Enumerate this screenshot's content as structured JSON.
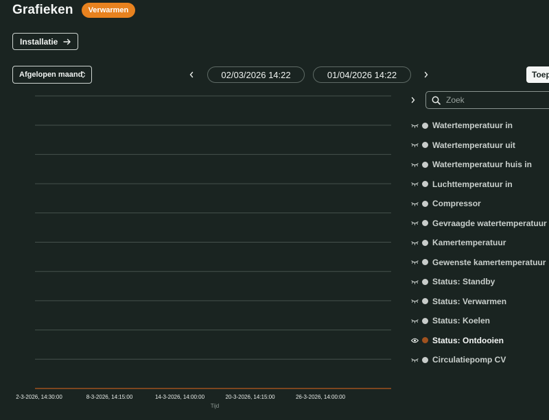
{
  "header": {
    "title": "Grafieken",
    "mode_badge": "Verwarmen"
  },
  "toolbar": {
    "installatie_label": "Installatie",
    "period_select": "Afgelopen maand",
    "date_from": "02/03/2026 14:22",
    "date_to": "01/04/2026 14:22",
    "apply_label": "Toep"
  },
  "chart_data": {
    "type": "line",
    "x": [
      "2-3-2026, 14:30:00",
      "8-3-2026, 14:15:00",
      "14-3-2026, 14:00:00",
      "20-3-2026, 14:15:00",
      "26-3-2026, 14:00:00"
    ],
    "xlabel": "Tijd",
    "ylabel": "",
    "grid": true,
    "series": [
      {
        "name": "Status: Ontdooien",
        "values": [
          0,
          0,
          0,
          0,
          0
        ],
        "color": "#a0521f"
      }
    ]
  },
  "sidebar": {
    "search_placeholder": "Zoek",
    "series": [
      {
        "label": "Watertemperatuur in",
        "visible": false,
        "color": "#c8ccca"
      },
      {
        "label": "Watertemperatuur uit",
        "visible": false,
        "color": "#c8ccca"
      },
      {
        "label": "Watertemperatuur huis in",
        "visible": false,
        "color": "#c8ccca"
      },
      {
        "label": "Luchttemperatuur in",
        "visible": false,
        "color": "#c8ccca"
      },
      {
        "label": "Compressor",
        "visible": false,
        "color": "#c8ccca"
      },
      {
        "label": "Gevraagde watertemperatuur",
        "visible": false,
        "color": "#c8ccca"
      },
      {
        "label": "Kamertemperatuur",
        "visible": false,
        "color": "#c8ccca"
      },
      {
        "label": "Gewenste kamertemperatuur",
        "visible": false,
        "color": "#c8ccca"
      },
      {
        "label": "Status: Standby",
        "visible": false,
        "color": "#c8ccca"
      },
      {
        "label": "Status: Verwarmen",
        "visible": false,
        "color": "#c8ccca"
      },
      {
        "label": "Status: Koelen",
        "visible": false,
        "color": "#c8ccca"
      },
      {
        "label": "Status: Ontdooien",
        "visible": true,
        "color": "#a0521f"
      },
      {
        "label": "Circulatiepomp CV",
        "visible": false,
        "color": "#c8ccca"
      }
    ]
  }
}
